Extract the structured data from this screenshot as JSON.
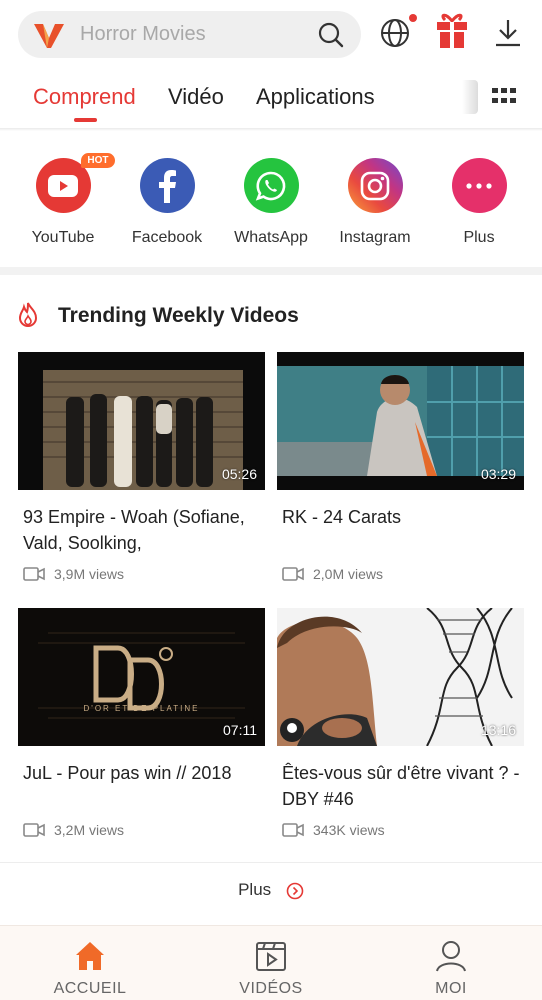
{
  "search": {
    "placeholder": "Horror Movies"
  },
  "tabs": [
    {
      "label": "Comprend",
      "active": true
    },
    {
      "label": "Vidéo",
      "active": false
    },
    {
      "label": "Applications",
      "active": false
    }
  ],
  "shortcuts": [
    {
      "label": "YouTube",
      "icon": "youtube-icon",
      "color": "#e53935",
      "badge": "HOT"
    },
    {
      "label": "Facebook",
      "icon": "facebook-icon",
      "color": "#3b5bb5"
    },
    {
      "label": "WhatsApp",
      "icon": "whatsapp-icon",
      "color": "#25c43f"
    },
    {
      "label": "Instagram",
      "icon": "instagram-icon",
      "color": "#c13584"
    },
    {
      "label": "Plus",
      "icon": "more-icon",
      "color": "#e5306a"
    }
  ],
  "section": {
    "title": "Trending Weekly Videos"
  },
  "videos": [
    {
      "title": "93 Empire - Woah (Sofiane, Vald, Soolking,",
      "duration": "05:26",
      "views": "3,9M views"
    },
    {
      "title": "RK - 24 Carats",
      "duration": "03:29",
      "views": "2,0M views"
    },
    {
      "title": "JuL - Pour pas win // 2018",
      "duration": "07:11",
      "views": "3,2M views",
      "thumb_text": "D'OR ET DE PLATINE"
    },
    {
      "title": "Êtes-vous sûr d'être vivant ? - DBY #46",
      "duration": "13:16",
      "views": "343K views"
    }
  ],
  "more": {
    "label": "Plus"
  },
  "bottom_nav": [
    {
      "label": "ACCUEIL",
      "icon": "home-icon",
      "active": true
    },
    {
      "label": "VIDÉOS",
      "icon": "video-icon",
      "active": false
    },
    {
      "label": "MOI",
      "icon": "profile-icon",
      "active": false
    }
  ],
  "colors": {
    "accent": "#e53935",
    "text": "#222222",
    "muted": "#777777"
  }
}
